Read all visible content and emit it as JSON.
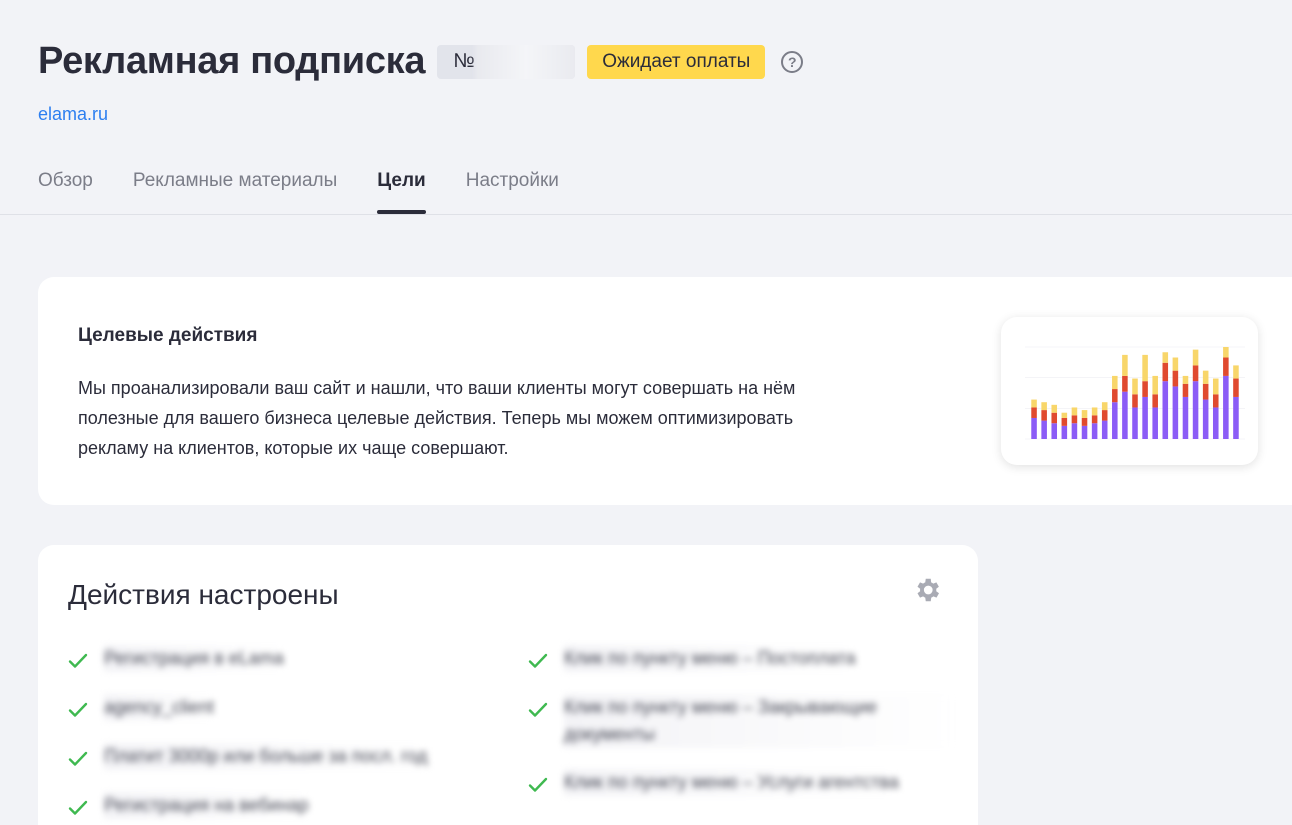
{
  "header": {
    "title": "Рекламная подписка",
    "number_prefix": "№",
    "status": "Ожидает оплаты",
    "help_symbol": "?"
  },
  "site_link": "elama.ru",
  "tabs": [
    {
      "label": "Обзор",
      "active": false
    },
    {
      "label": "Рекламные материалы",
      "active": false
    },
    {
      "label": "Цели",
      "active": true
    },
    {
      "label": "Настройки",
      "active": false
    }
  ],
  "intro": {
    "title": "Целевые действия",
    "text": "Мы проанализировали ваш сайт и нашли, что ваши клиенты могут совершать на нём полезные для вашего бизнеса целевые действия. Теперь мы можем оптимизировать рекламу на клиентов, которые их чаще совершают."
  },
  "goals": {
    "title": "Действия настроены",
    "left_items": [
      "Регистрация в eLama",
      "agency_client",
      "Платит 3000р или больше за посл. год",
      "Регистрация на вебинар"
    ],
    "right_items": [
      "Клик по пункту меню – Постоплата",
      "Клик по пункту меню – Закрывающие документы",
      "Клик по пункту меню – Услуги агентства"
    ]
  },
  "colors": {
    "accent_link": "#2d7ff0",
    "status_yellow": "#ffd84d",
    "check_green": "#3fb950",
    "bar_purple": "#8b5cf6",
    "bar_red": "#e04a2f",
    "bar_yellow": "#f8d66a"
  },
  "chart_data": {
    "type": "bar",
    "stacked": true,
    "series": [
      {
        "values": [
          8,
          7,
          6,
          5,
          6,
          5,
          6,
          7,
          14,
          18,
          12,
          16,
          12,
          22,
          20,
          16,
          22,
          15,
          12,
          24,
          16
        ]
      },
      {
        "values": [
          4,
          4,
          4,
          3,
          3,
          3,
          3,
          4,
          5,
          6,
          5,
          6,
          5,
          7,
          6,
          5,
          6,
          6,
          5,
          7,
          7
        ]
      },
      {
        "values": [
          3,
          3,
          3,
          2,
          3,
          3,
          3,
          3,
          5,
          8,
          6,
          10,
          7,
          4,
          5,
          3,
          6,
          5,
          6,
          4,
          5
        ]
      }
    ],
    "grid": true
  }
}
